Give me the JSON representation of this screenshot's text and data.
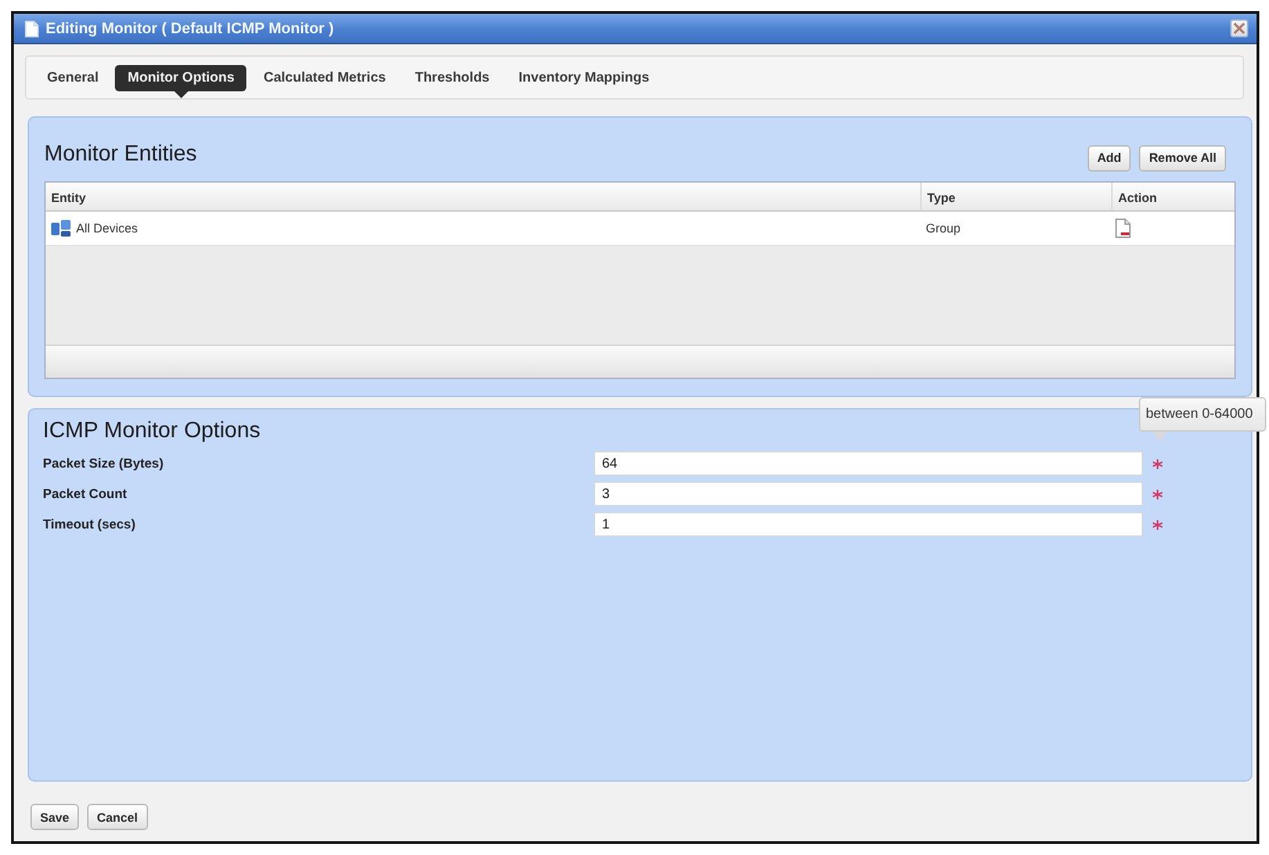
{
  "window": {
    "title": "Editing Monitor ( Default ICMP Monitor )"
  },
  "tabs": [
    {
      "label": "General",
      "selected": false
    },
    {
      "label": "Monitor Options",
      "selected": true
    },
    {
      "label": "Calculated Metrics",
      "selected": false
    },
    {
      "label": "Thresholds",
      "selected": false
    },
    {
      "label": "Inventory Mappings",
      "selected": false
    }
  ],
  "monitor_entities": {
    "title": "Monitor Entities",
    "buttons": [
      "Add",
      "Remove All"
    ],
    "table": {
      "columns": [
        "Entity",
        "Type",
        "Action"
      ],
      "rows": [
        {
          "entity": "All Devices",
          "type": "Group"
        }
      ]
    }
  },
  "icmp_options": {
    "title": "ICMP Monitor Options",
    "fields": [
      {
        "label": "Packet Size (Bytes)",
        "value": "64",
        "required": true,
        "tooltip": "between 0-64000"
      },
      {
        "label": "Packet Count",
        "value": "3",
        "required": true
      },
      {
        "label": "Timeout (secs)",
        "value": "1",
        "required": true
      }
    ]
  },
  "buttons": [
    "Save",
    "Cancel"
  ]
}
